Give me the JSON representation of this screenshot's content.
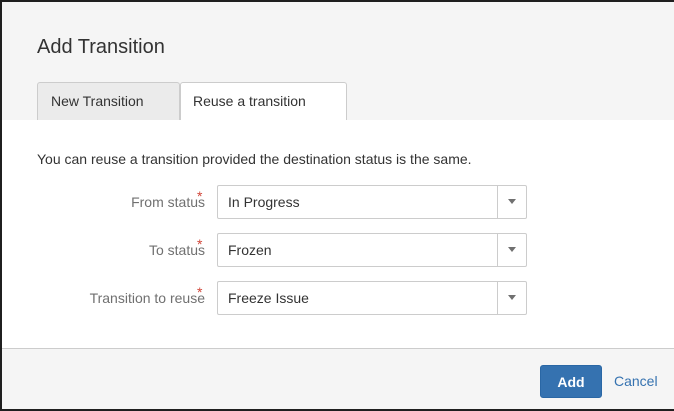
{
  "dialog": {
    "title": "Add Transition",
    "tabs": [
      {
        "label": "New Transition",
        "active": false
      },
      {
        "label": "Reuse a transition",
        "active": true
      }
    ],
    "intro": "You can reuse a transition provided the destination status is the same.",
    "fields": [
      {
        "label": "From status",
        "required_marker": "*",
        "value": "In Progress"
      },
      {
        "label": "To status",
        "required_marker": "*",
        "value": "Frozen"
      },
      {
        "label": "Transition to reuse",
        "required_marker": "*",
        "value": "Freeze Issue"
      }
    ],
    "actions": {
      "add_label": "Add",
      "cancel_label": "Cancel"
    }
  },
  "colors": {
    "primary_button": "#3572b0",
    "link": "#3572b0",
    "required": "#d04437",
    "header_bg": "#f5f5f5"
  },
  "icons": {
    "select_arrow": "chevron-down-icon"
  }
}
